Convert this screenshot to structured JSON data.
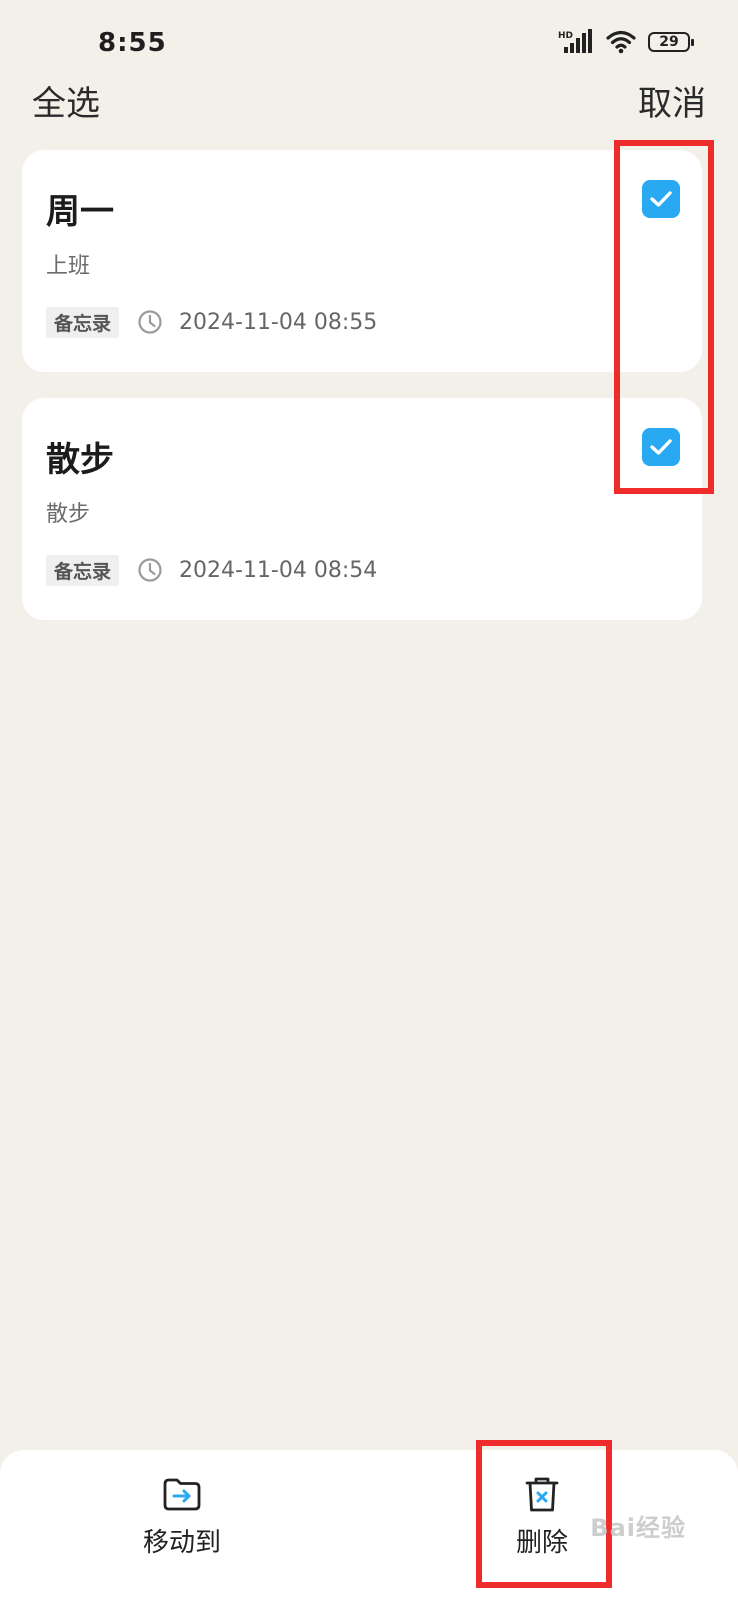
{
  "status_bar": {
    "time": "8:55",
    "network_label": "HD",
    "battery_level": "29"
  },
  "top_bar": {
    "select_all_label": "全选",
    "cancel_label": "取消"
  },
  "notes": [
    {
      "title": "周一",
      "body": "上班",
      "folder": "备忘录",
      "timestamp": "2024-11-04 08:55",
      "checked": true
    },
    {
      "title": "散步",
      "body": "散步",
      "folder": "备忘录",
      "timestamp": "2024-11-04 08:54",
      "checked": true
    }
  ],
  "bottom_bar": {
    "move_label": "移动到",
    "delete_label": "删除"
  },
  "watermark": "Bai经验",
  "colors": {
    "background": "#f3f0ea",
    "checkbox": "#29a9f2",
    "highlight": "#ee2c2c"
  },
  "icons": {
    "move": "folder-arrow-icon",
    "delete": "trash-icon",
    "time": "clock-icon",
    "check": "checkmark-icon"
  }
}
